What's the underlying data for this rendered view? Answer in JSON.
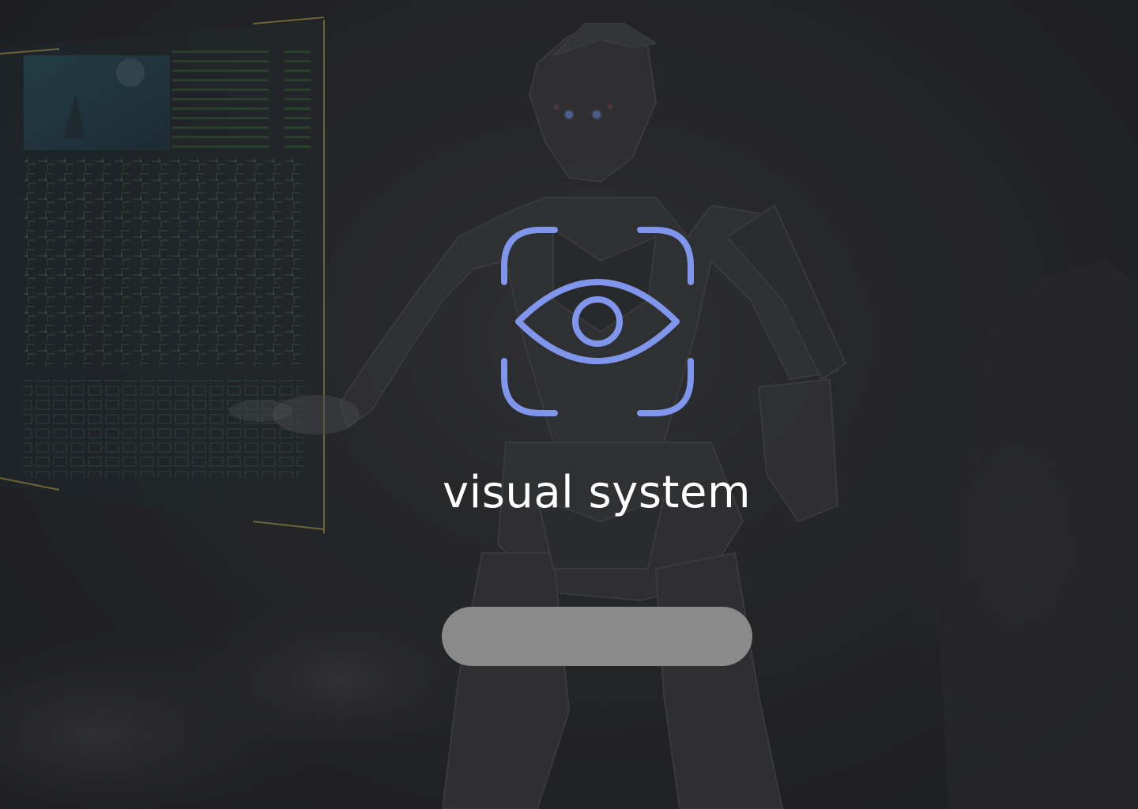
{
  "app": {
    "title": "visual system"
  },
  "logo": {
    "icon": "eye-scan-icon",
    "color": "#7f96ec"
  },
  "action_button": {
    "label": "",
    "color": "#8a8a8a"
  },
  "background": {
    "description_icon": "robot-hologram-illustration"
  }
}
